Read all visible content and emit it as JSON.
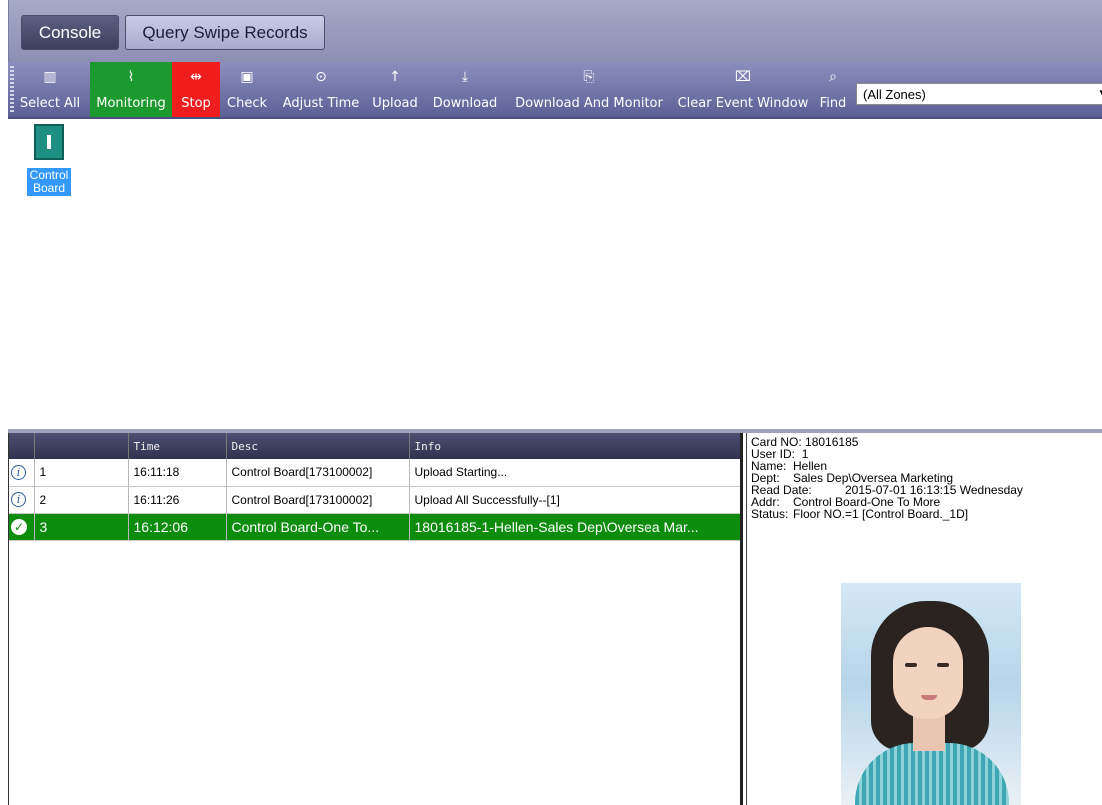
{
  "tabs": {
    "console": "Console",
    "query": "Query Swipe Records"
  },
  "toolbar": {
    "select_all": "Select All",
    "monitoring": "Monitoring",
    "stop": "Stop",
    "check": "Check",
    "adjust_time": "Adjust Time",
    "upload": "Upload",
    "download": "Download",
    "download_and_monitor": "Download And Monitor",
    "clear_event_window": "Clear Event Window",
    "find": "Find",
    "zone_selected": "(All Zones)"
  },
  "device": {
    "label_line1": "Control",
    "label_line2": "Board"
  },
  "events": {
    "headers": [
      "",
      "",
      "Time",
      "Desc",
      "Info"
    ],
    "rows": [
      {
        "status": "info",
        "no": "1",
        "time": "16:11:18",
        "desc": "Control Board[173100002]",
        "info": "Upload Starting..."
      },
      {
        "status": "info",
        "no": "2",
        "time": "16:11:26",
        "desc": "Control Board[173100002]",
        "info": "Upload All Successfully--[1]"
      },
      {
        "status": "ok",
        "no": "3",
        "time": "16:12:06",
        "desc": "Control Board-One To...",
        "info": "18016185-1-Hellen-Sales Dep\\Oversea Mar..."
      }
    ]
  },
  "detail": {
    "card_no_label": "Card NO:",
    "card_no": "18016185",
    "user_id_label": "User ID:",
    "user_id": "1",
    "name_label": "Name:",
    "name": "Hellen",
    "dept_label": "Dept:",
    "dept": "Sales Dep\\Oversea Marketing",
    "read_date_label": "Read Date:",
    "read_date": "2015-07-01 16:13:15 Wednesday",
    "addr_label": "Addr:",
    "addr": "Control Board-One To More",
    "status_label": "Status:",
    "status": "Floor NO.=1 [Control Board._1D]"
  },
  "colors": {
    "monitoring": "#1d9a2f",
    "stop": "#ef1d1d",
    "selected_row": "#0e8c0e",
    "device_label": "#3399ff",
    "toolbar": "#6e71a4"
  }
}
